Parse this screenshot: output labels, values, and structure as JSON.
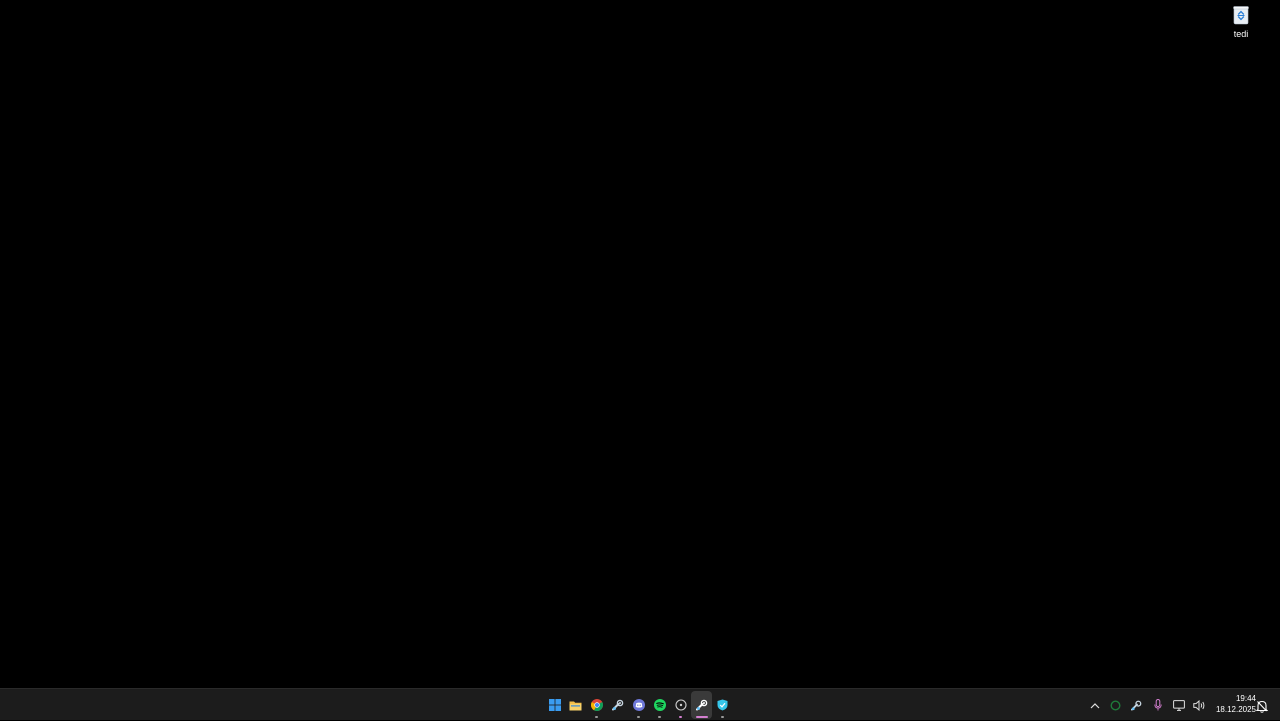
{
  "desktop": {
    "icons": [
      {
        "label": "tedi",
        "icon": "recycle-bin-icon"
      }
    ]
  },
  "taskbar": {
    "apps": [
      {
        "name": "start",
        "icon": "windows-start-icon",
        "running": false,
        "active": false
      },
      {
        "name": "file-explorer",
        "icon": "folder-icon",
        "running": false,
        "active": false
      },
      {
        "name": "chrome",
        "icon": "chrome-icon",
        "running": true,
        "active": false
      },
      {
        "name": "steam",
        "icon": "steam-icon",
        "running": false,
        "active": false
      },
      {
        "name": "discord",
        "icon": "discord-icon",
        "running": true,
        "active": false
      },
      {
        "name": "spotify",
        "icon": "spotify-icon",
        "running": true,
        "active": false
      },
      {
        "name": "unknown-app",
        "icon": "circle-app-icon",
        "running": true,
        "active": false
      },
      {
        "name": "steam-active",
        "icon": "steam-icon",
        "running": true,
        "active": true
      },
      {
        "name": "vpn",
        "icon": "shield-icon",
        "running": true,
        "active": false
      }
    ],
    "tray": {
      "icons": [
        "chevron-up-icon",
        "nvidia-icon",
        "steam-tray-icon",
        "microphone-icon",
        "network-icon",
        "volume-icon"
      ],
      "time": "19:44",
      "date": "18.12.2025",
      "notification_icon": "notification-bell-icon"
    }
  },
  "colors": {
    "desktop_bg": "#000000",
    "taskbar_bg": "#1c1c1c",
    "accent_pink": "#d47fd0"
  }
}
